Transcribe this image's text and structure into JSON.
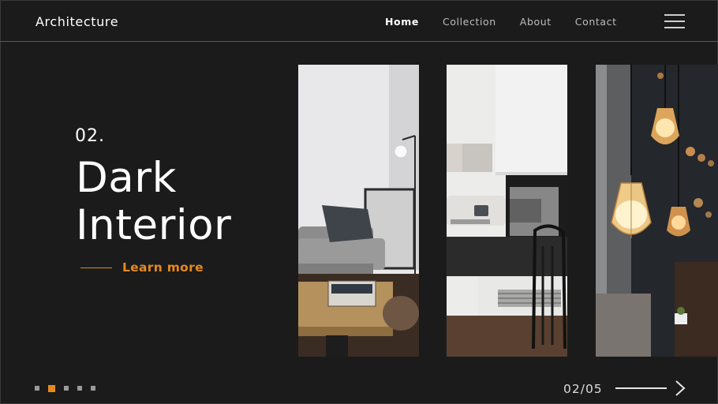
{
  "header": {
    "logo": "Architecture",
    "nav": [
      {
        "label": "Home",
        "active": true
      },
      {
        "label": "Collection",
        "active": false
      },
      {
        "label": "About",
        "active": false
      },
      {
        "label": "Contact",
        "active": false
      }
    ]
  },
  "hero": {
    "slide_number": "02.",
    "title_line1": "Dark",
    "title_line2": "Interior",
    "cta": "Learn more"
  },
  "gallery": {
    "images": [
      "living-room-sofa-photo",
      "fireplace-interior-photo",
      "pendant-lamps-cafe-photo"
    ]
  },
  "footer": {
    "pagination": {
      "total": 5,
      "active_index": 1
    },
    "counter": "02/05"
  },
  "colors": {
    "background": "#1b1b1b",
    "accent": "#e58a1f",
    "text": "#ffffff"
  }
}
